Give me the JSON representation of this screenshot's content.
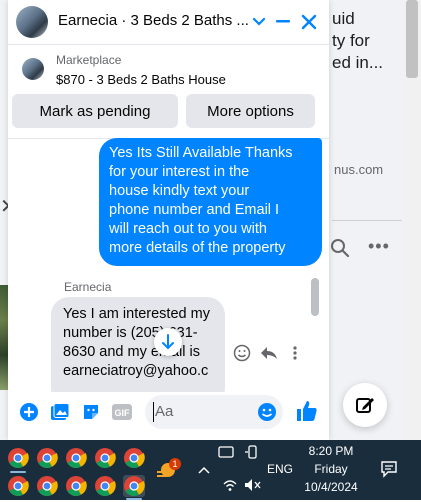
{
  "background": {
    "snippet": "uid\nty for\ned in...",
    "domain_text": "nus.com",
    "more_label": "•••"
  },
  "chat": {
    "title": "Earnecia · 3 Beds 2 Baths ...",
    "marketplace_label": "Marketplace",
    "listing_title": "$870 - 3 Beds 2 Baths House",
    "actions": {
      "pending_label": "Mark as pending",
      "more_label": "More options"
    },
    "messages": [
      {
        "direction": "outgoing",
        "text": "Yes Its Still Available Thanks\nfor your interest in the\nhouse kindly text your\nphone number and Email I\nwill reach out to you with\nmore details of the property"
      },
      {
        "direction": "incoming",
        "sender": "Earnecia",
        "text": "Yes I am interested my\nnumber is (205) 631-\n8630 and my email is\nearneciatroy@yahoo.c"
      }
    ],
    "composer": {
      "placeholder": "Aa"
    }
  },
  "taskbar": {
    "time": "8:20 PM",
    "day": "Friday",
    "date": "10/4/2024",
    "language": "ENG",
    "badge_count": "1"
  },
  "colors": {
    "messenger_blue": "#0084ff",
    "taskbar_bg": "#1a2d3c",
    "bubble_gray": "#e4e6eb"
  }
}
